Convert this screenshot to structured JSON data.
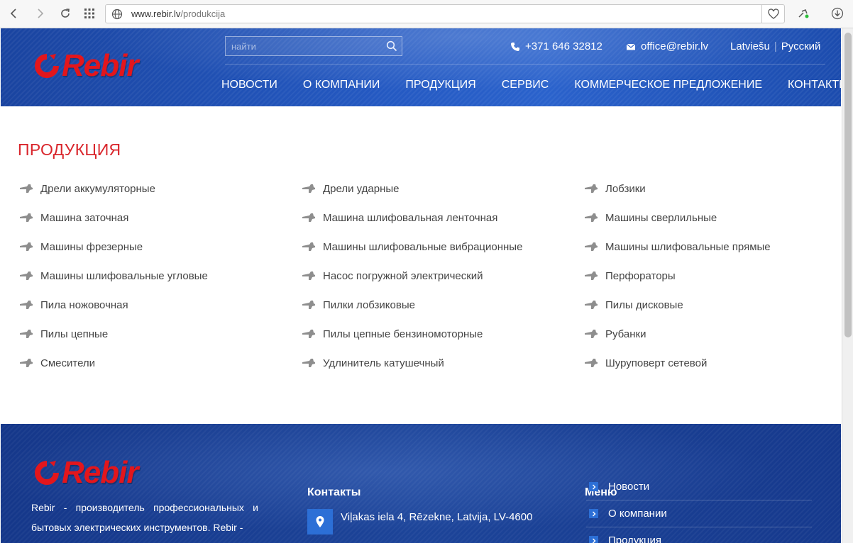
{
  "browser": {
    "url_domain": "www.rebir.lv",
    "url_path": "/produkcija"
  },
  "header": {
    "logo_text": "Rebir",
    "search_placeholder": "найти",
    "phone": "+371 646 32812",
    "email": "office@rebir.lv",
    "languages": [
      "Latviešu",
      "Русский"
    ],
    "nav": [
      "НОВОСТИ",
      "О КОМПАНИИ",
      "ПРОДУКЦИЯ",
      "СЕРВИС",
      "КОММЕРЧЕСКОЕ ПРЕДЛОЖЕНИЕ",
      "КОНТАКТЫ"
    ]
  },
  "page": {
    "title": "ПРОДУКЦИЯ",
    "columns": [
      [
        {
          "label": "Дрели аккумуляторные",
          "icon": "cordless-drill-icon"
        },
        {
          "label": "Машина заточная",
          "icon": "bench-grinder-icon"
        },
        {
          "label": "Машины фрезерные",
          "icon": "router-icon"
        },
        {
          "label": "Машины шлифовальные угловые",
          "icon": "angle-grinder-icon"
        },
        {
          "label": "Пила ножовочная",
          "icon": "reciprocating-saw-icon"
        },
        {
          "label": "Пилы цепные",
          "icon": "chainsaw-icon"
        },
        {
          "label": "Смесители",
          "icon": "mixer-icon"
        }
      ],
      [
        {
          "label": "Дрели ударные",
          "icon": "impact-drill-icon"
        },
        {
          "label": "Машина шлифовальная ленточная",
          "icon": "belt-sander-icon"
        },
        {
          "label": "Машины шлифовальные вибрационные",
          "icon": "orbital-sander-icon"
        },
        {
          "label": "Насос погружной электрический",
          "icon": "submersible-pump-icon"
        },
        {
          "label": "Пилки лобзиковые",
          "icon": "jigsaw-blade-icon"
        },
        {
          "label": "Пилы цепные бензиномоторные",
          "icon": "petrol-chainsaw-icon"
        },
        {
          "label": "Удлинитель катушечный",
          "icon": "cable-reel-icon"
        }
      ],
      [
        {
          "label": "Лобзики",
          "icon": "jigsaw-icon"
        },
        {
          "label": "Машины сверлильные",
          "icon": "drill-icon"
        },
        {
          "label": "Машины шлифовальные прямые",
          "icon": "die-grinder-icon"
        },
        {
          "label": "Перфораторы",
          "icon": "rotary-hammer-icon"
        },
        {
          "label": "Пилы дисковые",
          "icon": "circular-saw-icon"
        },
        {
          "label": "Рубанки",
          "icon": "planer-icon"
        },
        {
          "label": "Шуруповерт сетевой",
          "icon": "screwdriver-icon"
        }
      ]
    ]
  },
  "footer": {
    "logo_text": "Rebir",
    "about": "Rebir - производитель профессиональных и бытовых электрических инструментов. Rebir -",
    "contacts_title": "Контакты",
    "address": "Viļakas iela 4, Rēzekne, Latvija, LV-4600",
    "menu_title": "Меню",
    "menu": [
      "Новости",
      "О компании",
      "Продукция"
    ]
  },
  "colors": {
    "accent_red": "#d9262c",
    "header_blue": "#2459c2",
    "footer_blue": "#1c4499",
    "icon_blue": "#2c6fd6"
  }
}
